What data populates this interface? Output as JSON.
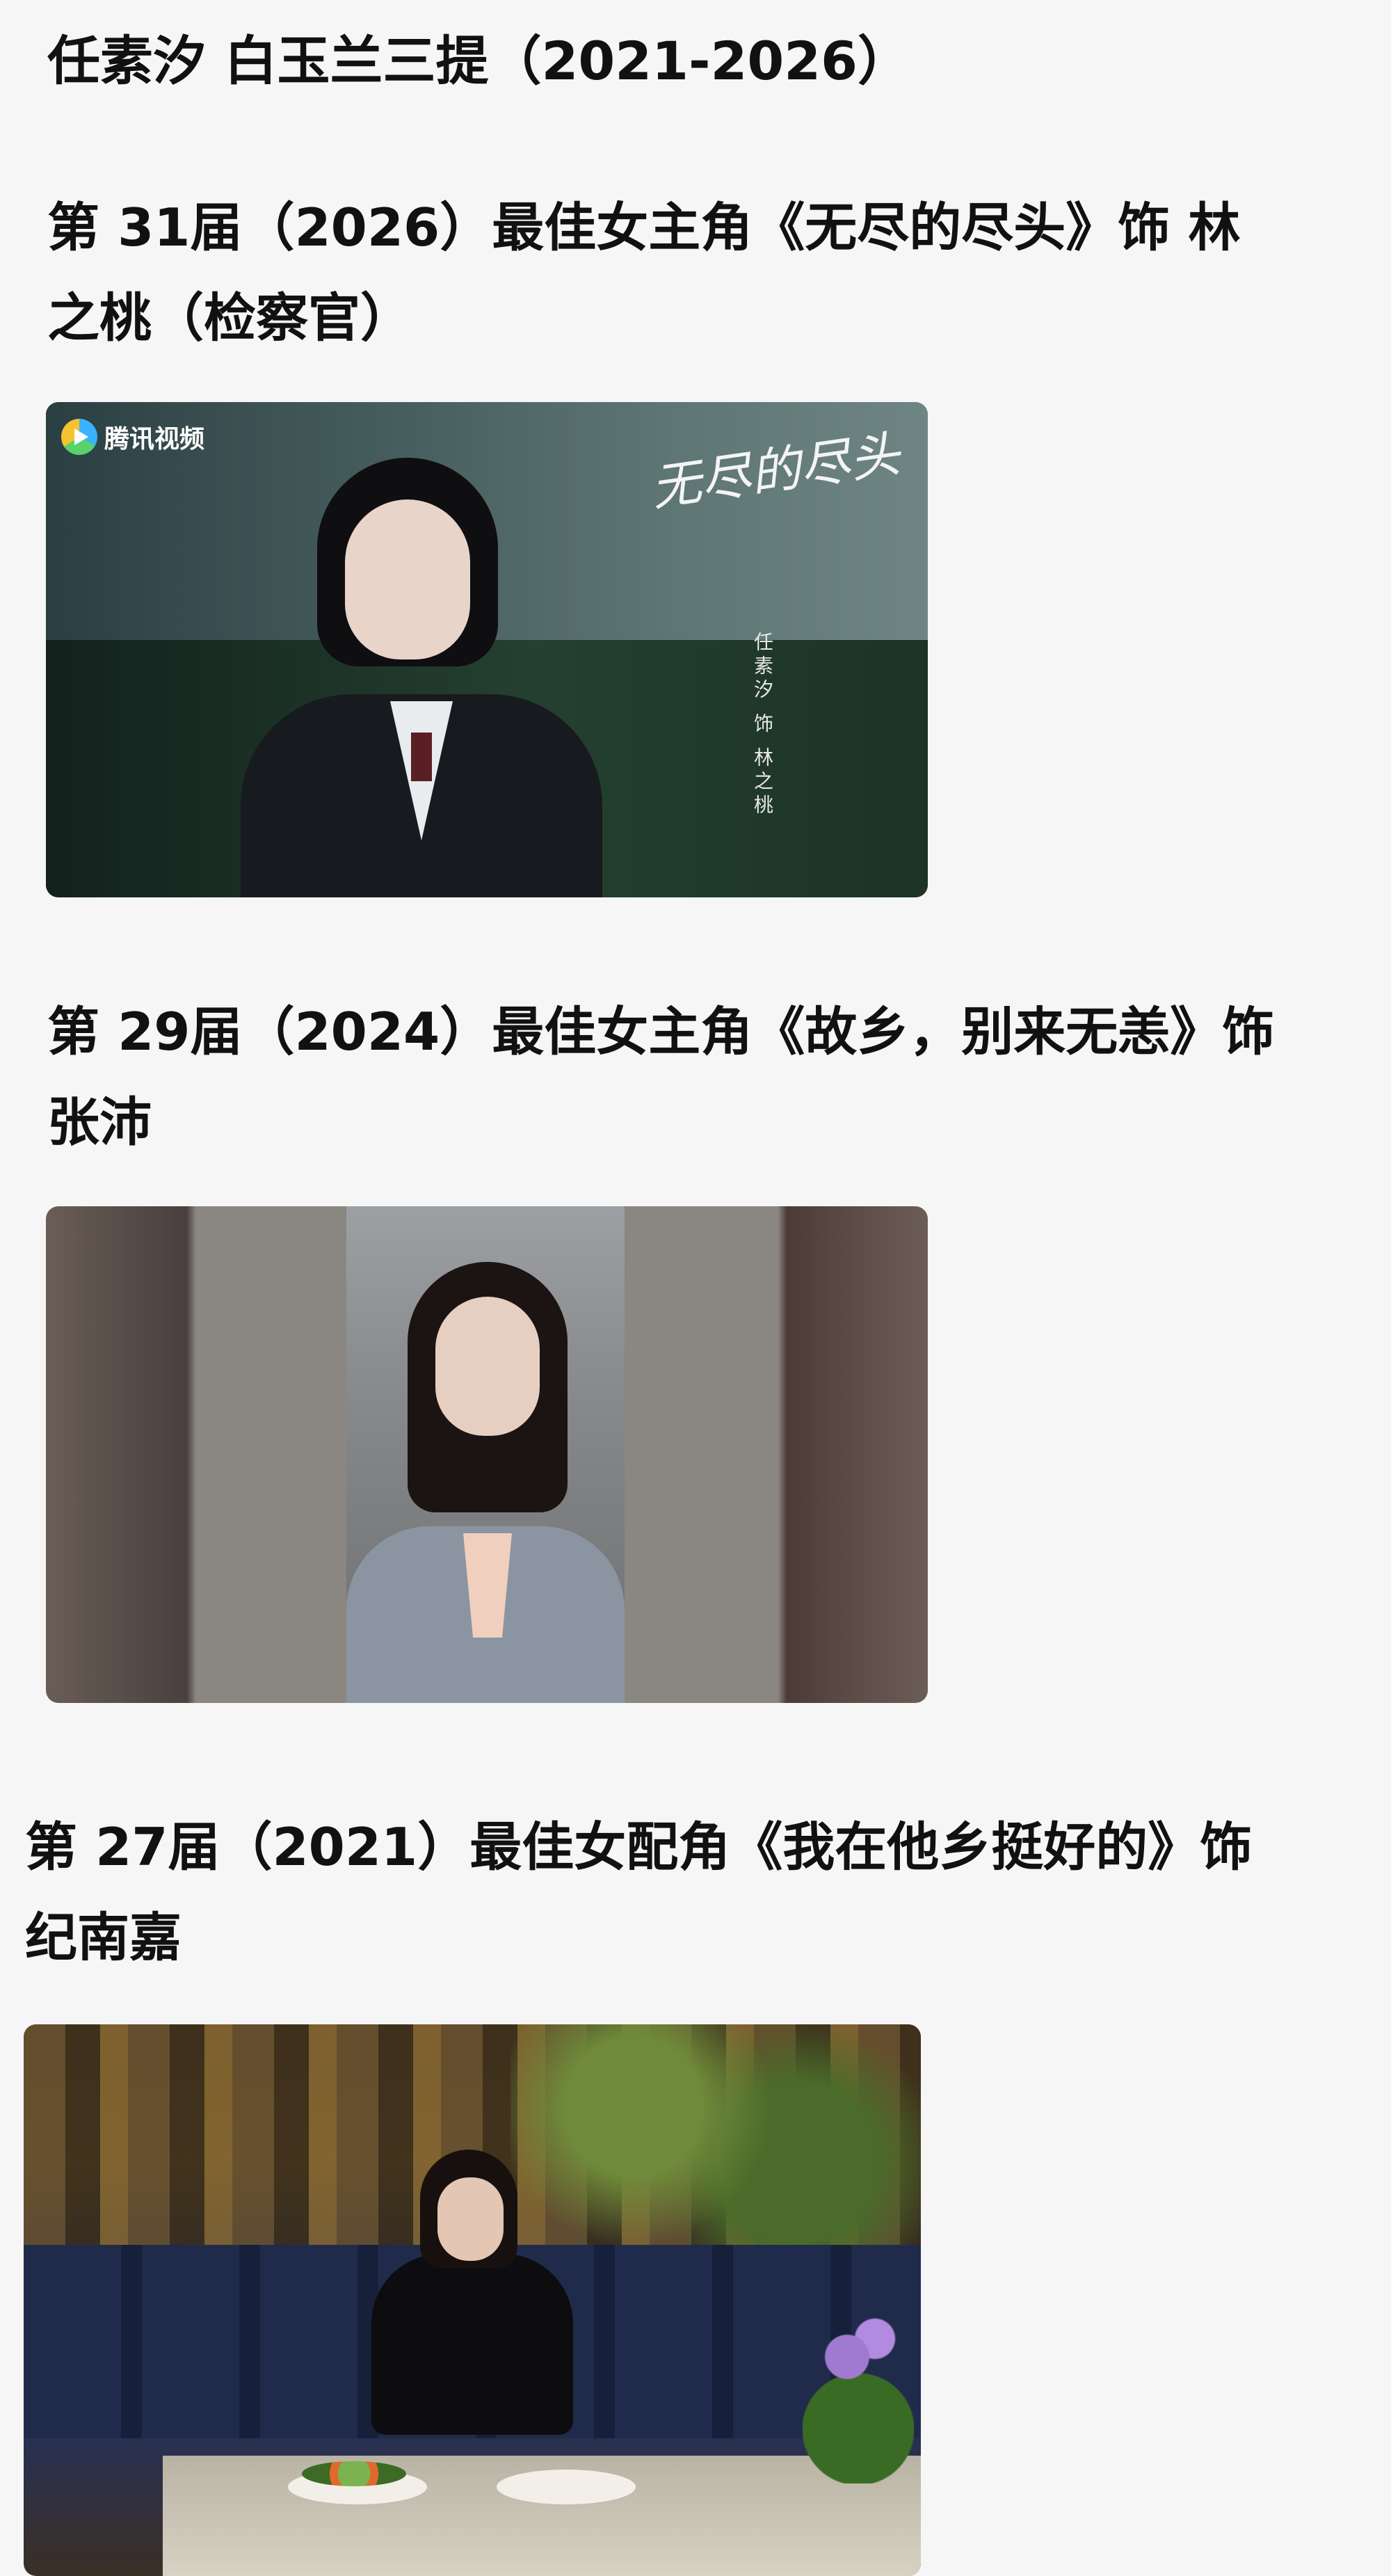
{
  "post": {
    "title": "任素汐 白玉兰三提（2021-2026）",
    "sections": [
      {
        "heading_line1": "第 31届（2026）最佳女主角《无尽的尽头》饰 林",
        "heading_line2": "之桃（检察官）",
        "image": {
          "logo_text": "腾讯视频",
          "calligraphy_title": "无尽的尽头",
          "credit": "任素汐 饰 林之桃"
        }
      },
      {
        "heading_line1": "第 29届（2024）最佳女主角《故乡，别来无恙》饰",
        "heading_line2": "张沛"
      },
      {
        "heading_line1": "第 27届（2021）最佳女配角《我在他乡挺好的》饰",
        "heading_line2": "纪南嘉"
      }
    ]
  }
}
